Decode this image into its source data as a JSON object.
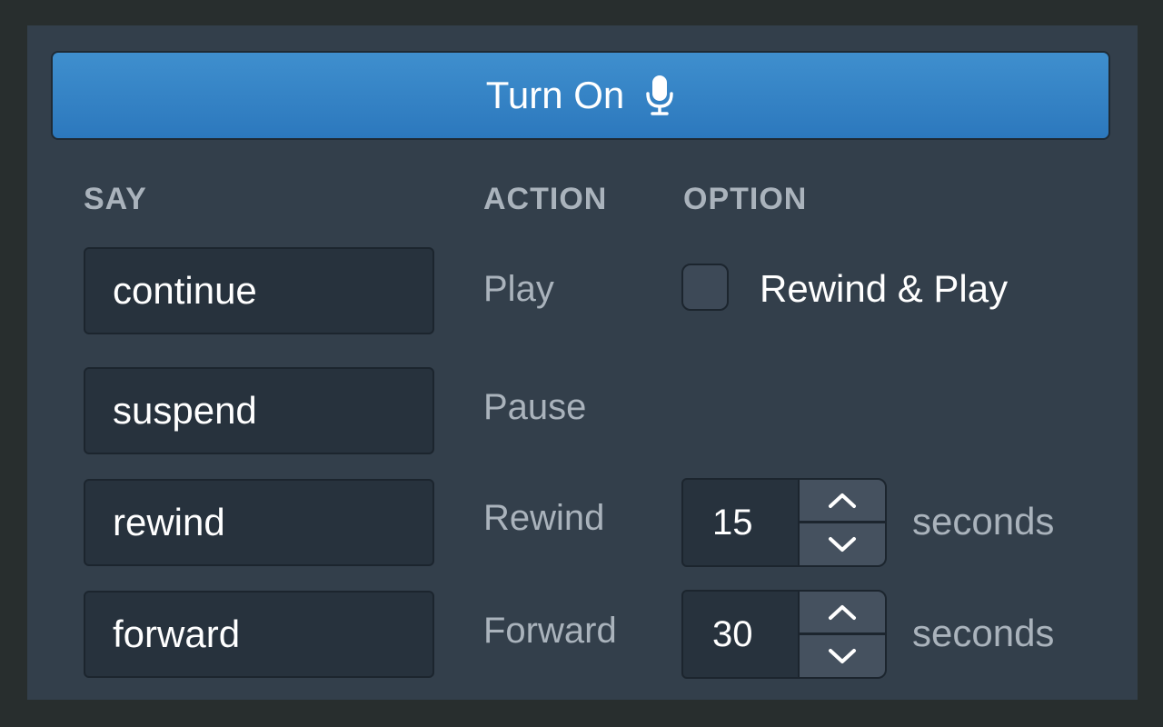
{
  "turn_on_button": {
    "label": "Turn On",
    "icon": "microphone-icon"
  },
  "headers": {
    "say": "SAY",
    "action": "ACTION",
    "option": "OPTION"
  },
  "rows": [
    {
      "say": "continue",
      "action": "Play",
      "option": {
        "type": "checkbox",
        "label": "Rewind & Play",
        "checked": false
      }
    },
    {
      "say": "suspend",
      "action": "Pause"
    },
    {
      "say": "rewind",
      "action": "Rewind",
      "option": {
        "type": "stepper",
        "value": "15",
        "unit": "seconds"
      }
    },
    {
      "say": "forward",
      "action": "Forward",
      "option": {
        "type": "stepper",
        "value": "30",
        "unit": "seconds"
      }
    }
  ],
  "colors": {
    "accent": "#2f7dc1",
    "panel": "#333f4b",
    "background": "#282e2e"
  }
}
